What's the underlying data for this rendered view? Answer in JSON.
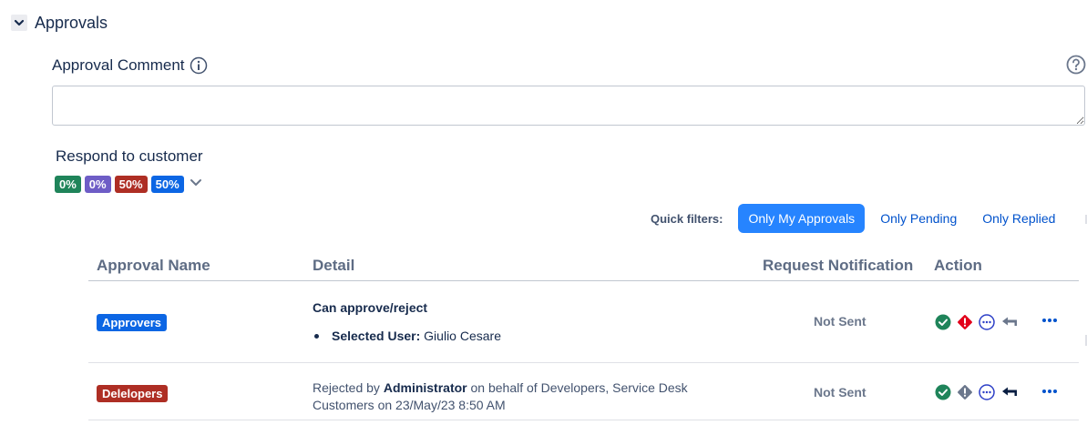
{
  "section": {
    "title": "Approvals",
    "icon": "chevron-down-icon"
  },
  "comment": {
    "label": "Approval Comment",
    "value": "",
    "placeholder": ""
  },
  "respond": {
    "label": "Respond to customer",
    "badges": [
      {
        "text": "0%",
        "color": "#1f845a"
      },
      {
        "text": "0%",
        "color": "#6e5dc6"
      },
      {
        "text": "50%",
        "color": "#ae2e24"
      },
      {
        "text": "50%",
        "color": "#0c66e4"
      }
    ]
  },
  "quick_filters": {
    "label": "Quick filters:",
    "buttons": [
      "Only My Approvals",
      "Only Pending",
      "Only Replied"
    ],
    "active_index": 0
  },
  "table": {
    "headers": [
      "Approval Name",
      "Detail",
      "Request Notification",
      "Action"
    ],
    "rows": [
      {
        "name": "Approvers",
        "name_color": "#0c66e4",
        "detail_title": "Can approve/reject",
        "detail_key": "Selected User:",
        "detail_value": "Giulio Cesare",
        "notification": "Not Sent",
        "actions": [
          "approve-check-icon",
          "reject-exclamation-icon",
          "comment-ellipsis-icon",
          "reply-arrow-icon"
        ]
      },
      {
        "name": "Delelopers",
        "name_color": "#ae2e24",
        "detail_prefix": "Rejected by",
        "detail_actor": "Administrator",
        "detail_suffix": "on behalf of Developers, Service Desk Customers on 23/May/23 8:50 AM",
        "notification": "Not Sent",
        "actions": [
          "approve-check-icon",
          "reject-exclamation-icon",
          "comment-ellipsis-icon",
          "reply-arrow-icon"
        ]
      }
    ]
  },
  "colors": {
    "accent": "#2684ff",
    "link": "#0052cc",
    "approve": "#1f845a",
    "reject": "#e2001a"
  }
}
